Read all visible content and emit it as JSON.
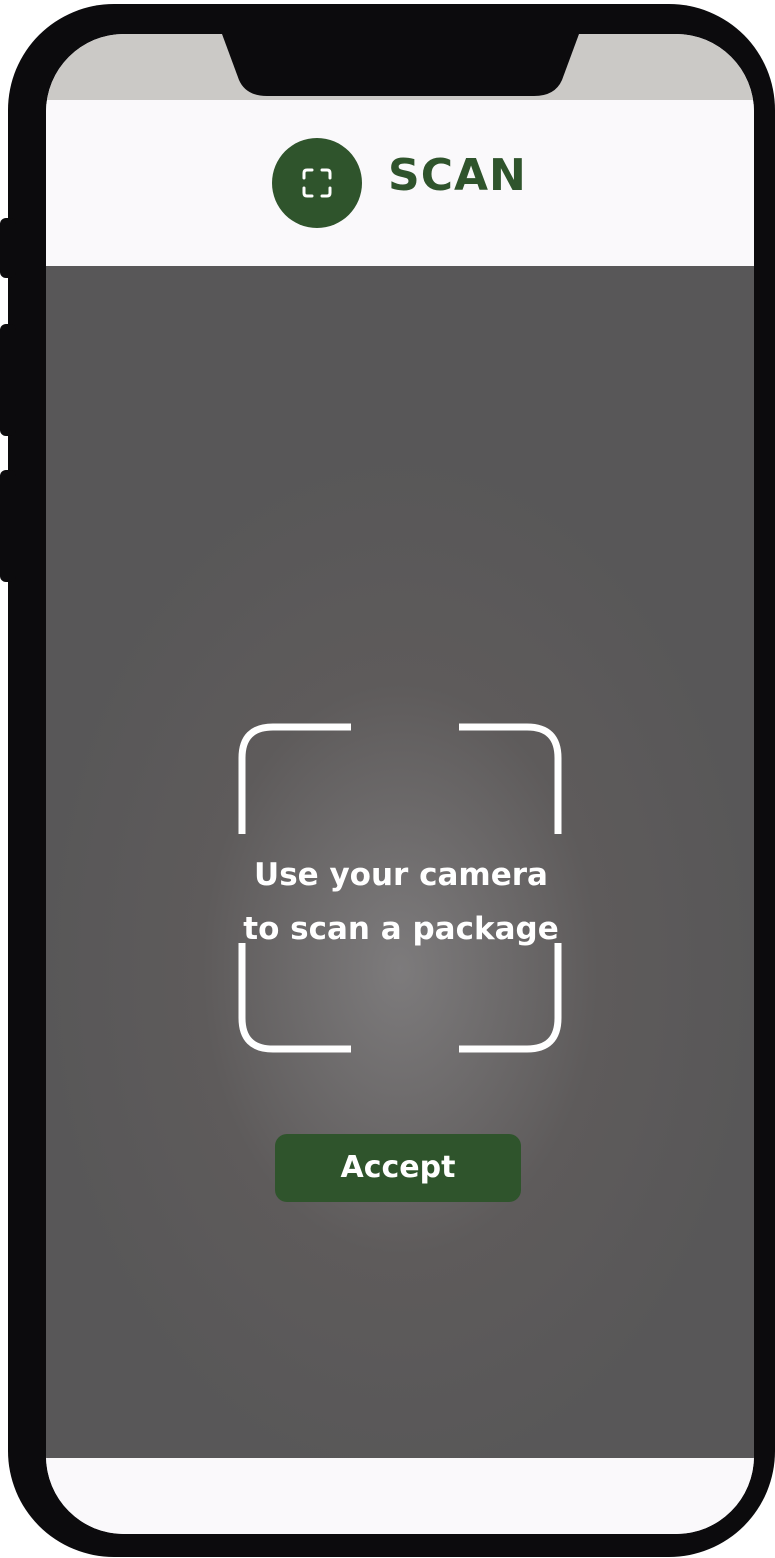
{
  "header": {
    "title": "SCAN",
    "icon": "scan-frame-icon"
  },
  "scanner": {
    "hint_line1": "Use your camera",
    "hint_line2": "to scan a package",
    "accept_label": "Accept"
  },
  "colors": {
    "brand_green": "#2f542c",
    "device_frame": "#0c0b0d",
    "camera_bg": "#5e5b5b",
    "header_bg": "#faf9fb"
  }
}
